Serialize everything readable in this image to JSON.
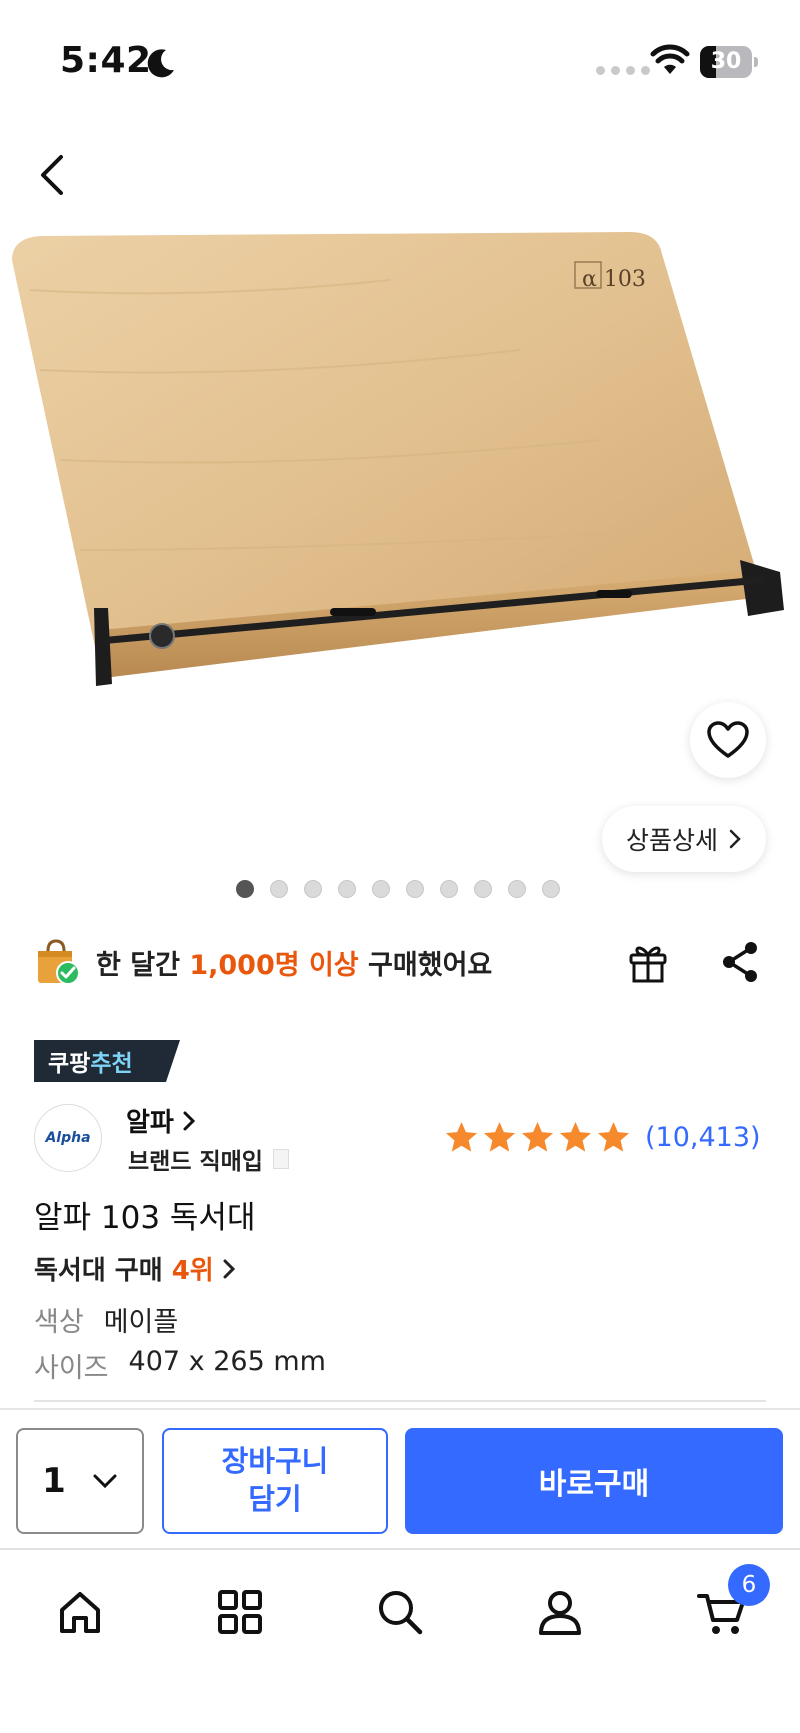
{
  "status_bar": {
    "time": "5:42",
    "battery": "30",
    "battery_level": 0.3
  },
  "product": {
    "image_logo": "α 103",
    "detail_label": "상품상세",
    "gallery": {
      "total": 10,
      "active_index": 0
    },
    "social_proof": {
      "prefix": "한 달간 ",
      "highlight": "1,000명 이상",
      "suffix": " 구매했어요"
    },
    "badge": {
      "part1": "쿠팡",
      "part2": "추천"
    },
    "brand": {
      "logo_text": "Alpha",
      "name": "알파",
      "type": "브랜드 직매입"
    },
    "rating": {
      "stars": 5,
      "count": "(10,413)"
    },
    "title": "알파 103 독서대",
    "rank": {
      "prefix": "독서대 구매 ",
      "highlight": "4위"
    },
    "options": [
      {
        "label": "색상",
        "value": "메이플"
      },
      {
        "label": "사이즈",
        "value": "407 x 265 mm"
      }
    ]
  },
  "purchase_bar": {
    "quantity": "1",
    "cart_label": "장바구니\n담기",
    "buy_label": "바로구매"
  },
  "bottom_nav": {
    "items": [
      "home-icon",
      "categories-icon",
      "search-icon",
      "my-account-icon",
      "cart-icon"
    ],
    "cart_count": "6"
  },
  "colors": {
    "accent": "#346aff",
    "highlight": "#e8570c",
    "star": "#f7892d",
    "badge_bg": "#1f2a36",
    "badge_accent": "#7fd3f6"
  }
}
